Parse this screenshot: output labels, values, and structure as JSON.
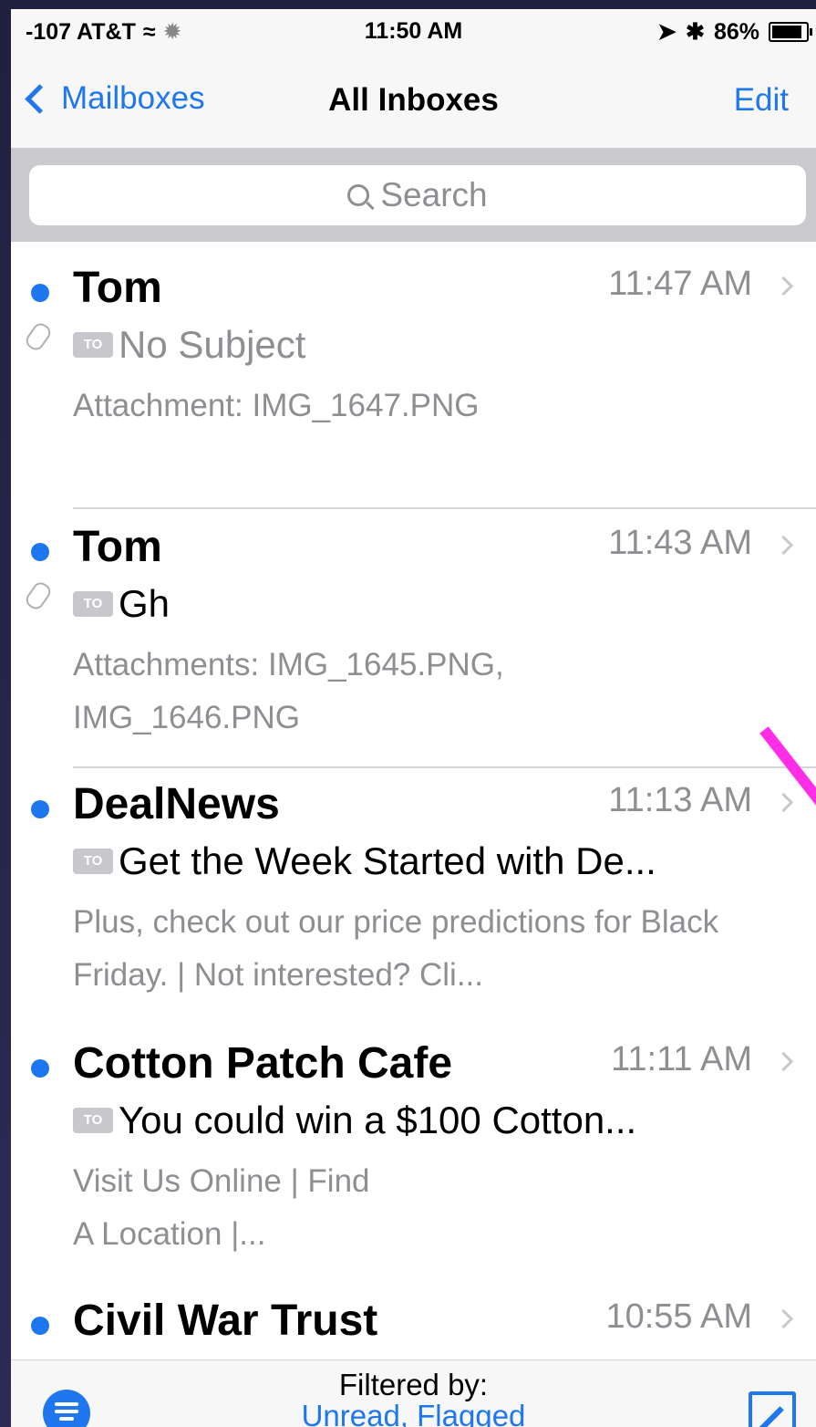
{
  "status_bar": {
    "carrier": "-107 AT&T",
    "time": "11:50 AM",
    "battery": "86%"
  },
  "nav": {
    "back_label": "Mailboxes",
    "title": "All Inboxes",
    "edit_label": "Edit"
  },
  "search": {
    "placeholder": "Search"
  },
  "messages": [
    {
      "sender": "Tom",
      "time": "11:47 AM",
      "subject": "No Subject",
      "preview": "Attachment: IMG_1647.PNG",
      "unread": true,
      "attachment": true,
      "subject_read_style": true
    },
    {
      "sender": "Tom",
      "time": "11:43 AM",
      "subject": "Gh",
      "preview": "Attachments: IMG_1645.PNG, IMG_1646.PNG",
      "unread": true,
      "attachment": true,
      "subject_read_style": false
    },
    {
      "sender": "DealNews",
      "time": "11:13 AM",
      "subject": "Get the Week Started with De...",
      "preview": "Plus, check out our price predictions for Black Friday. | Not interested? Cli...",
      "unread": true,
      "attachment": false,
      "subject_read_style": false
    },
    {
      "sender": "Cotton Patch Cafe",
      "time": "11:11 AM",
      "subject": "You could win a $100 Cotton...",
      "preview": "Visit Us Online | Find A Location |...",
      "unread": true,
      "attachment": false,
      "subject_read_style": false
    },
    {
      "sender": "Civil War Trust",
      "time": "10:55 AM",
      "subject": "",
      "preview": "",
      "unread": true,
      "attachment": false,
      "subject_read_style": false
    }
  ],
  "to_badge": "TO",
  "toolbar": {
    "filtered_by": "Filtered by:",
    "filters": "Unread, Flagged"
  },
  "colors": {
    "accent": "#1e77ee",
    "annotation": "#ff2de6"
  }
}
